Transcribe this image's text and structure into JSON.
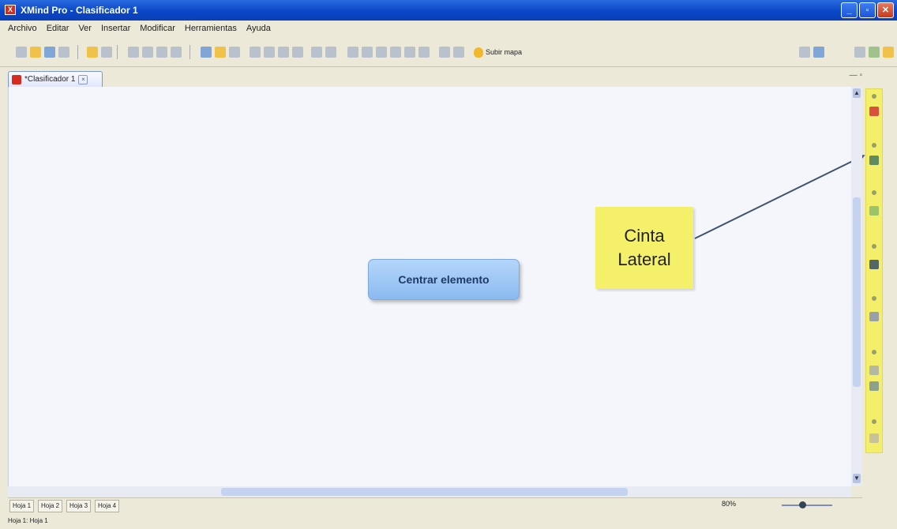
{
  "window": {
    "title": "XMind Pro - Clasificador 1",
    "controls": [
      "_",
      "▫",
      "✕"
    ]
  },
  "menu": [
    "Archivo",
    "Editar",
    "Ver",
    "Insertar",
    "Modificar",
    "Herramientas",
    "Ayuda"
  ],
  "toolbar": {
    "map_button_label": "Subir mapa"
  },
  "tab": {
    "label": "*Clasificador 1"
  },
  "canvas": {
    "central_topic": "Centrar elemento",
    "callout": {
      "line1": "Cinta",
      "line2": "Lateral"
    }
  },
  "sheets": [
    "Hoja 1",
    "Hoja 2",
    "Hoja 3",
    "Hoja 4"
  ],
  "zoom": "80%",
  "status": "Hoja 1: Hoja 1",
  "colors": {
    "titlebar": "#0a46c8",
    "callout": "#f5f06a",
    "central": "#8bbaf0",
    "ribbon": "#f3ef6b"
  }
}
